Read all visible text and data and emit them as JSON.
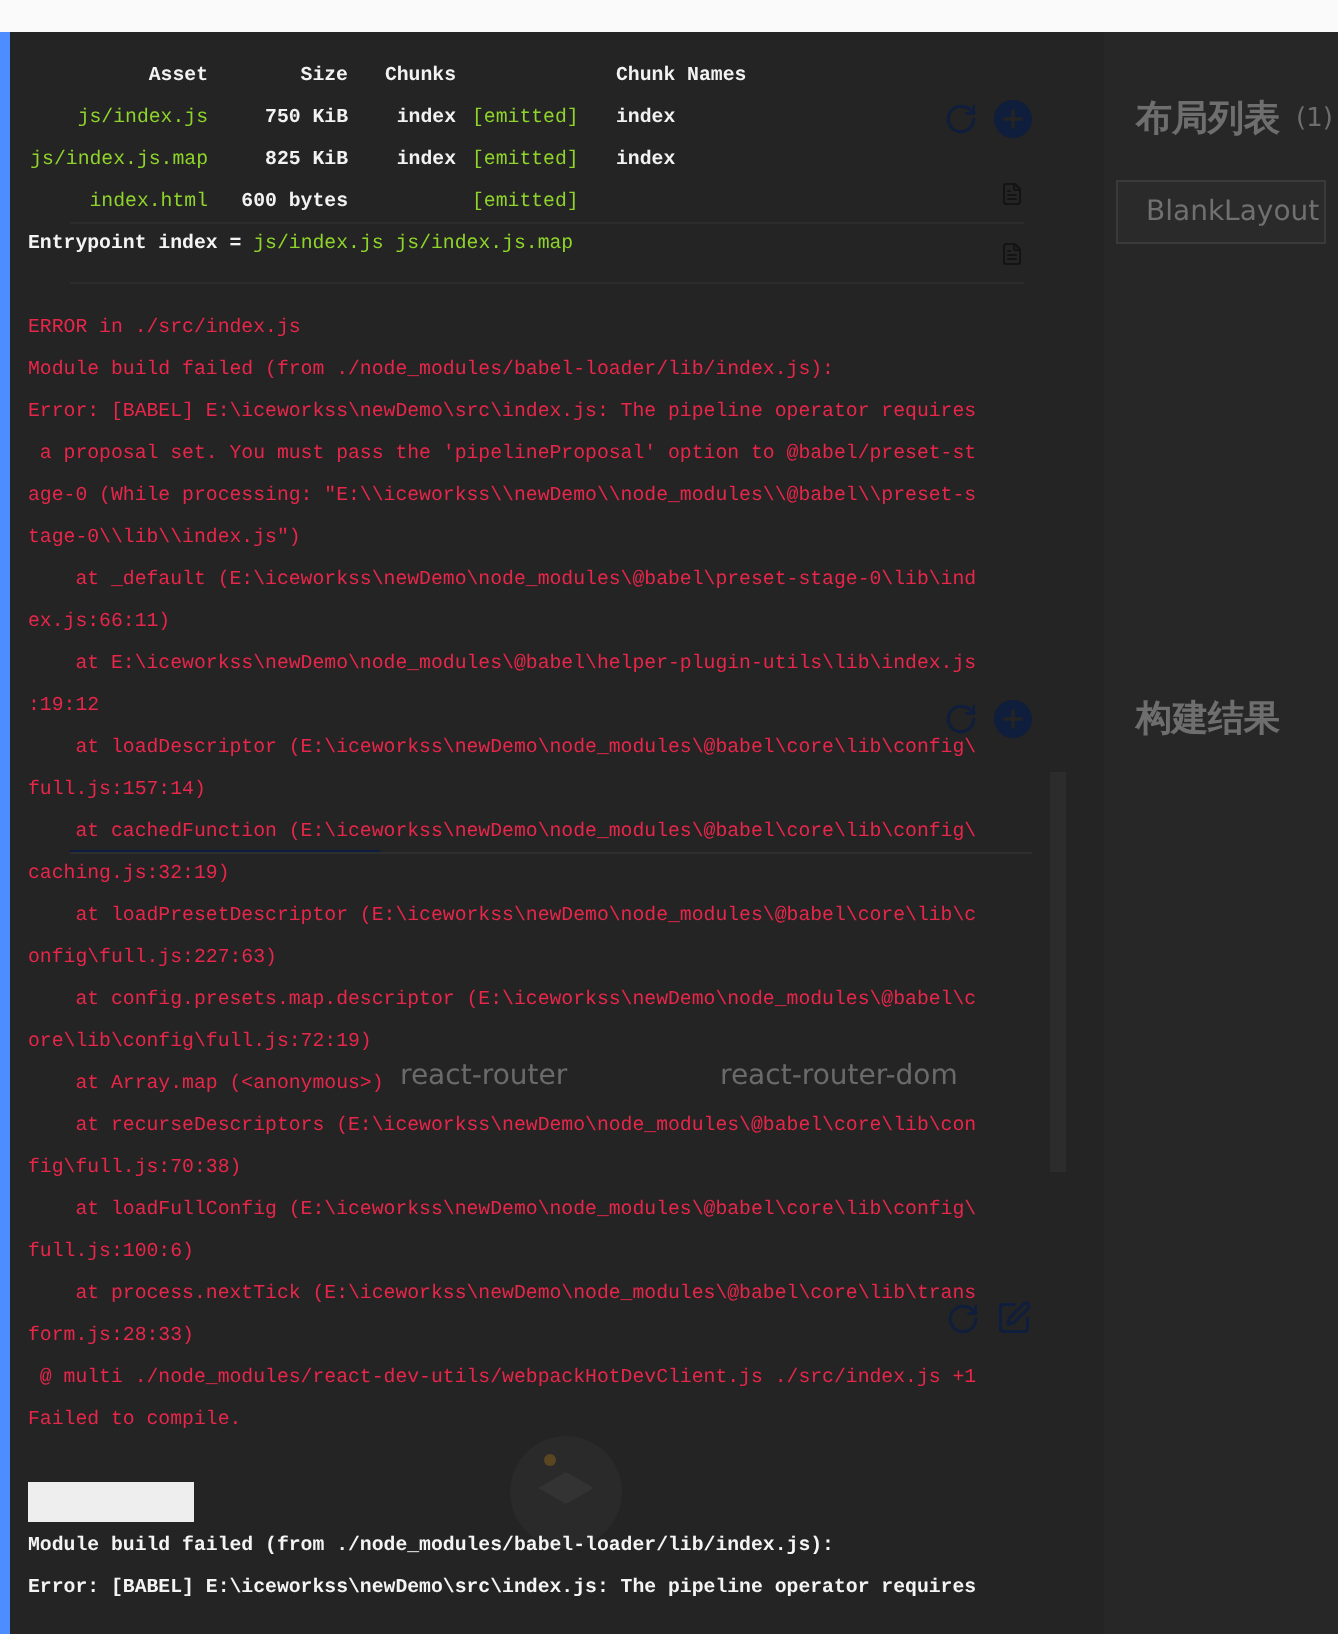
{
  "app": {
    "dependencies": {
      "packages": [
        {
          "name": "react-router"
        },
        {
          "name": "react-router-dom"
        }
      ]
    },
    "layout_list": {
      "title": "布局列表",
      "count": "(1)",
      "items": [
        "BlankLayout"
      ]
    },
    "build_result": {
      "title": "构建结果"
    }
  },
  "console": {
    "asset_table": {
      "columns": [
        "Asset",
        "Size",
        "Chunks",
        "",
        "Chunk Names"
      ],
      "rows": [
        {
          "asset": "js/index.js",
          "size": "750 KiB",
          "chunks": "index",
          "status": "[emitted]",
          "chunk_names": "index"
        },
        {
          "asset": "js/index.js.map",
          "size": "825 KiB",
          "chunks": "index",
          "status": "[emitted]",
          "chunk_names": "index"
        },
        {
          "asset": "index.html",
          "size": "600 bytes",
          "status": "[emitted]"
        }
      ]
    },
    "entrypoint": {
      "label": "Entrypoint index =",
      "files": "js/index.js js/index.js.map"
    },
    "error_lines": [
      "ERROR in ./src/index.js",
      "Module build failed (from ./node_modules/babel-loader/lib/index.js):",
      "Error: [BABEL] E:\\iceworkss\\newDemo\\src\\index.js: The pipeline operator requires",
      " a proposal set. You must pass the 'pipelineProposal' option to @babel/preset-st",
      "age-0 (While processing: \"E:\\\\iceworkss\\\\newDemo\\\\node_modules\\\\@babel\\\\preset-s",
      "tage-0\\\\lib\\\\index.js\")",
      "    at _default (E:\\iceworkss\\newDemo\\node_modules\\@babel\\preset-stage-0\\lib\\ind",
      "ex.js:66:11)",
      "    at E:\\iceworkss\\newDemo\\node_modules\\@babel\\helper-plugin-utils\\lib\\index.js",
      ":19:12",
      "    at loadDescriptor (E:\\iceworkss\\newDemo\\node_modules\\@babel\\core\\lib\\config\\",
      "full.js:157:14)",
      "    at cachedFunction (E:\\iceworkss\\newDemo\\node_modules\\@babel\\core\\lib\\config\\",
      "caching.js:32:19)",
      "    at loadPresetDescriptor (E:\\iceworkss\\newDemo\\node_modules\\@babel\\core\\lib\\c",
      "onfig\\full.js:227:63)",
      "    at config.presets.map.descriptor (E:\\iceworkss\\newDemo\\node_modules\\@babel\\c",
      "ore\\lib\\config\\full.js:72:19)",
      "    at Array.map (<anonymous>)",
      "    at recurseDescriptors (E:\\iceworkss\\newDemo\\node_modules\\@babel\\core\\lib\\con",
      "fig\\full.js:70:38)",
      "    at loadFullConfig (E:\\iceworkss\\newDemo\\node_modules\\@babel\\core\\lib\\config\\",
      "full.js:100:6)",
      "    at process.nextTick (E:\\iceworkss\\newDemo\\node_modules\\@babel\\core\\lib\\trans",
      "form.js:28:33)",
      " @ multi ./node_modules/react-dev-utils/webpackHotDevClient.js ./src/index.js +1",
      "Failed to compile."
    ],
    "summary_lines": [
      "Module build failed (from ./node_modules/babel-loader/lib/index.js):",
      "Error: [BABEL] E:\\iceworkss\\newDemo\\src\\index.js: The pipeline operator requires"
    ]
  }
}
